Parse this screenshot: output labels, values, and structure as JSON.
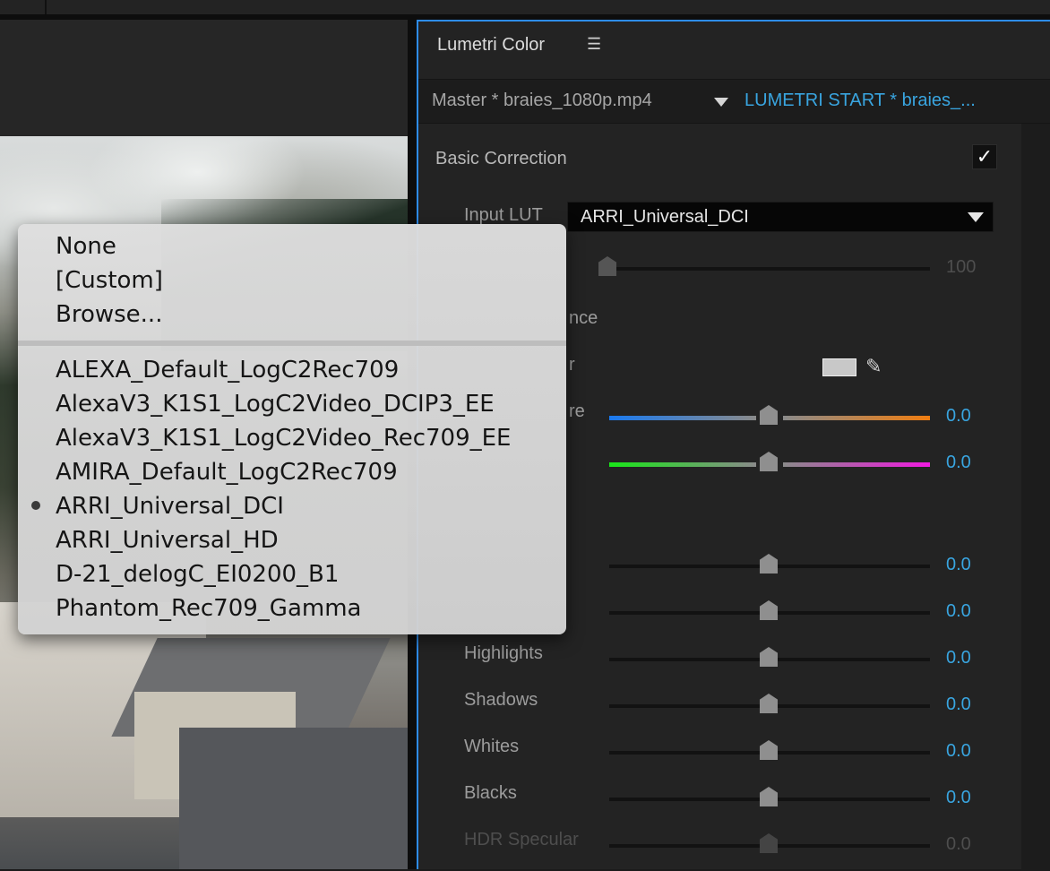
{
  "lumetri": {
    "title": "Lumetri Color",
    "menu_icon": "hamburger-icon",
    "tabs": {
      "master": "Master * braies_1080p.mp4",
      "clip": "LUMETRI START * braies_..."
    }
  },
  "basic_correction": {
    "title": "Basic Correction",
    "enabled": "✓",
    "input_lut_label": "Input LUT",
    "input_lut_value": "ARRI_Universal_DCI",
    "intensity_value": "100",
    "white_balance_fragment": "nce",
    "wb_selector_fragment": "r",
    "temperature_fragment": "re",
    "temperature_value": "0.0",
    "tint_value": "0.0"
  },
  "tone": {
    "rows": [
      {
        "label": "",
        "value": "0.0"
      },
      {
        "label": "",
        "value": "0.0"
      },
      {
        "label": "Highlights",
        "value": "0.0"
      },
      {
        "label": "Shadows",
        "value": "0.0"
      },
      {
        "label": "Whites",
        "value": "0.0"
      },
      {
        "label": "Blacks",
        "value": "0.0"
      },
      {
        "label": "HDR Specular",
        "value": "0.0"
      }
    ]
  },
  "lut_menu": {
    "top_items": [
      "None",
      "[Custom]",
      "Browse..."
    ],
    "items": [
      "ALEXA_Default_LogC2Rec709",
      "AlexaV3_K1S1_LogC2Video_DCIP3_EE",
      "AlexaV3_K1S1_LogC2Video_Rec709_EE",
      "AMIRA_Default_LogC2Rec709",
      "ARRI_Universal_DCI",
      "ARRI_Universal_HD",
      "D-21_delogC_EI0200_B1",
      "Phantom_Rec709_Gamma"
    ],
    "selected": "ARRI_Universal_DCI"
  },
  "colors": {
    "accent": "#39a5e0",
    "panel_border": "#2d8ceb"
  }
}
